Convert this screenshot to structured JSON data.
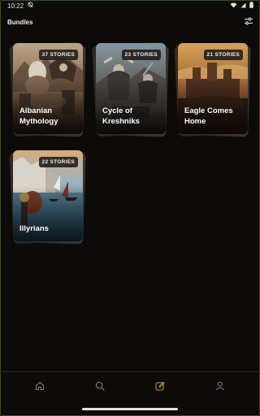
{
  "status_bar": {
    "time": "10:22"
  },
  "header": {
    "title": "Bundles"
  },
  "bundles": [
    {
      "title": "Albanian Mythology",
      "stories": "37 STORIES"
    },
    {
      "title": "Cycle of Kreshniks",
      "stories": "23 STORIES"
    },
    {
      "title": "Eagle Comes Home",
      "stories": "21 STORIES"
    },
    {
      "title": "Illyrians",
      "stories": "22 STORIES"
    }
  ],
  "bottom_nav": {
    "items": [
      "home-icon",
      "search-icon",
      "edit-icon",
      "profile-icon"
    ],
    "active": "edit-icon"
  },
  "colors": {
    "background": "#0d0b09",
    "accent_active": "#c9a24a",
    "nav_inactive": "#8d8882"
  }
}
